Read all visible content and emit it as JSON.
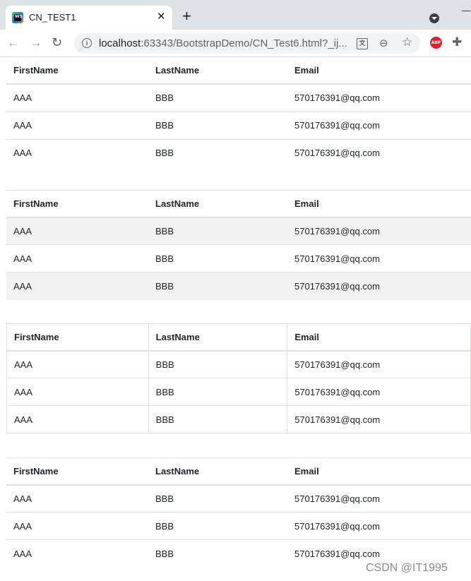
{
  "browser": {
    "tab_title": "CN_TEST1",
    "tab_close": "✕",
    "new_tab": "+",
    "url_host": "localhost",
    "url_path": ":63343/BootstrapDemo/CN_Test6.html?_ij...",
    "favicon_text": "WS",
    "abp_text": "ABP"
  },
  "tables": [
    {
      "headers": [
        "FirstName",
        "LastName",
        "Email"
      ],
      "rows": [
        [
          "AAA",
          "BBB",
          "570176391@qq.com"
        ],
        [
          "AAA",
          "BBB",
          "570176391@qq.com"
        ],
        [
          "AAA",
          "BBB",
          "570176391@qq.com"
        ]
      ]
    },
    {
      "headers": [
        "FirstName",
        "LastName",
        "Email"
      ],
      "rows": [
        [
          "AAA",
          "BBB",
          "570176391@qq.com"
        ],
        [
          "AAA",
          "BBB",
          "570176391@qq.com"
        ],
        [
          "AAA",
          "BBB",
          "570176391@qq.com"
        ]
      ]
    },
    {
      "headers": [
        "FirstName",
        "LastName",
        "Email"
      ],
      "rows": [
        [
          "AAA",
          "BBB",
          "570176391@qq.com"
        ],
        [
          "AAA",
          "BBB",
          "570176391@qq.com"
        ],
        [
          "AAA",
          "BBB",
          "570176391@qq.com"
        ]
      ]
    },
    {
      "headers": [
        "FirstName",
        "LastName",
        "Email"
      ],
      "rows": [
        [
          "AAA",
          "BBB",
          "570176391@qq.com"
        ],
        [
          "AAA",
          "BBB",
          "570176391@qq.com"
        ],
        [
          "AAA",
          "BBB",
          "570176391@qq.com"
        ]
      ]
    }
  ],
  "watermark": "CSDN @IT1995",
  "colors": {
    "tabstrip": "#dee1e6",
    "stripe": "#f2f2f2",
    "border": "#dee2e6"
  }
}
